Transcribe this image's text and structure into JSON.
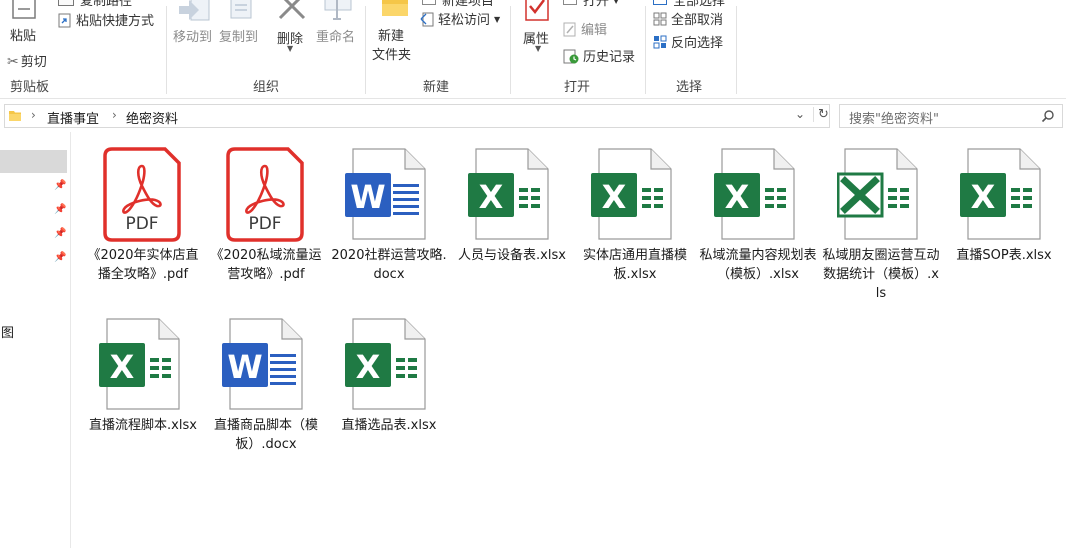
{
  "ribbon": {
    "clipboard": {
      "label": "剪贴板",
      "paste": "粘贴",
      "paste_shortcut": "粘贴快捷方式",
      "cut": "剪切",
      "top_cut": "复制路径"
    },
    "organize": {
      "label": "组织",
      "move_to": "移动到",
      "copy_to": "复制到",
      "delete": "删除",
      "rename": "重命名"
    },
    "new": {
      "label": "新建",
      "new_folder_line1": "新建",
      "new_folder_line2": "文件夹",
      "top_item": "新建项目",
      "easy_access": "轻松访问"
    },
    "open": {
      "label": "打开",
      "properties": "属性",
      "open": "打开",
      "edit": "编辑",
      "history": "历史记录"
    },
    "select": {
      "label": "选择",
      "select_all": "全部选择",
      "select_none": "全部取消",
      "invert": "反向选择"
    }
  },
  "address": {
    "crumbs": [
      "直播事宜",
      "绝密资料"
    ]
  },
  "search": {
    "placeholder": "搜索\"绝密资料\""
  },
  "nav": {
    "partial_label": "图"
  },
  "files": [
    {
      "name": "《2020年实体店直播全攻略》.pdf",
      "type": "pdf"
    },
    {
      "name": "《2020私域流量运营攻略》.pdf",
      "type": "pdf"
    },
    {
      "name": "2020社群运营攻略.docx",
      "type": "word"
    },
    {
      "name": "人员与设备表.xlsx",
      "type": "excel"
    },
    {
      "name": "实体店通用直播模板.xlsx",
      "type": "excel"
    },
    {
      "name": "私域流量内容规划表（模板）.xlsx",
      "type": "excel"
    },
    {
      "name": "私域朋友圈运营互动数据统计（模板）.xls",
      "type": "excel-old"
    },
    {
      "name": "直播SOP表.xlsx",
      "type": "excel"
    },
    {
      "name": "直播流程脚本.xlsx",
      "type": "excel"
    },
    {
      "name": "直播商品脚本（模板）.docx",
      "type": "word"
    },
    {
      "name": "直播选品表.xlsx",
      "type": "excel"
    }
  ],
  "icons": {
    "pdf_glyph": "PDF",
    "word_glyph": "W",
    "excel_glyph": "X"
  },
  "colors": {
    "pdf": "#e0302b",
    "word": "#2b5fc0",
    "excel": "#1f7a44",
    "accent": "#0078d7"
  }
}
